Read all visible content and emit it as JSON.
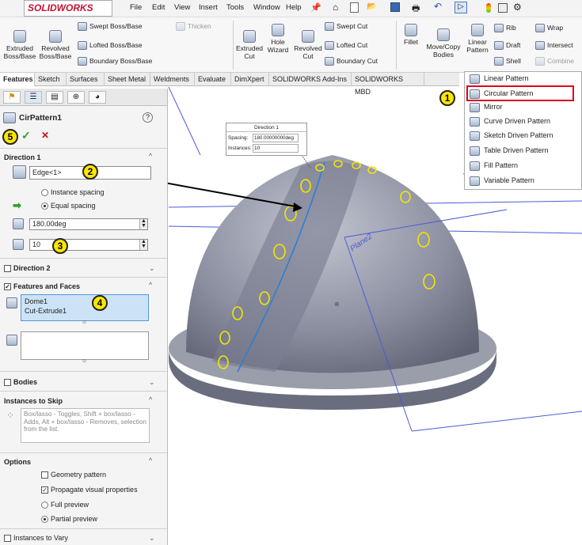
{
  "app": {
    "brand": "SOLIDWORKS"
  },
  "menu": [
    "File",
    "Edit",
    "View",
    "Insert",
    "Tools",
    "Window",
    "Help"
  ],
  "ribbon": {
    "extruded_boss": "Extruded Boss/Base",
    "revolved_boss": "Revolved Boss/Base",
    "swept_boss": "Swept Boss/Base",
    "lofted_boss": "Lofted Boss/Base",
    "boundary_boss": "Boundary Boss/Base",
    "thicken": "Thicken",
    "extruded_cut": "Extruded Cut",
    "hole_wizard": "Hole Wizard",
    "revolved_cut": "Revolved Cut",
    "swept_cut": "Swept Cut",
    "lofted_cut": "Lofted Cut",
    "boundary_cut": "Boundary Cut",
    "fillet": "Fillet",
    "move_copy": "Move/Copy Bodies",
    "linear_pattern": "Linear Pattern",
    "rib": "Rib",
    "wrap": "Wrap",
    "draft": "Draft",
    "intersect": "Intersect",
    "shell": "Shell",
    "combine": "Combine"
  },
  "tabs": [
    "Features",
    "Sketch",
    "Surfaces",
    "Sheet Metal",
    "Weldments",
    "Evaluate",
    "DimXpert",
    "SOLIDWORKS Add-Ins",
    "SOLIDWORKS MBD"
  ],
  "dropdown": [
    "Linear Pattern",
    "Circular Pattern",
    "Mirror",
    "Curve Driven Pattern",
    "Sketch Driven Pattern",
    "Table Driven Pattern",
    "Fill Pattern",
    "Variable Pattern"
  ],
  "pm": {
    "title": "CirPattern1",
    "help": "?",
    "ok": "✓",
    "cancel": "✕",
    "direction1": "Direction 1",
    "edge_value": "Edge<1>",
    "instance_spacing": "Instance spacing",
    "equal_spacing": "Equal spacing",
    "angle_value": "180.00deg",
    "instances_value": "10",
    "direction2": "Direction 2",
    "features_faces": "Features and Faces",
    "features_list": [
      "Dome1",
      "Cut-Extrude1"
    ],
    "bodies": "Bodies",
    "instances_to_skip": "Instances to Skip",
    "skip_hint": "Box/lasso - Toggles, Shift + box/lasso - Adds, Alt + box/lasso - Removes, selection from the list.",
    "options": "Options",
    "geometry_pattern": "Geometry pattern",
    "propagate": "Propagate visual properties",
    "full_preview": "Full preview",
    "partial_preview": "Partial preview",
    "instances_to_vary": "Instances to Vary"
  },
  "callouts": [
    "1",
    "2",
    "3",
    "4",
    "5"
  ],
  "dirbox": {
    "title": "Direction 1",
    "spacing_label": "Spacing:",
    "spacing_value": "180.00000000deg",
    "instances_label": "Instances:",
    "instances_value": "10"
  },
  "viewport": {
    "plane_label": "Plane2"
  },
  "colors": {
    "highlight": "#e0001b",
    "callout": "#ffe600",
    "accent": "#2d7fd1",
    "hole": "#f2e600"
  }
}
